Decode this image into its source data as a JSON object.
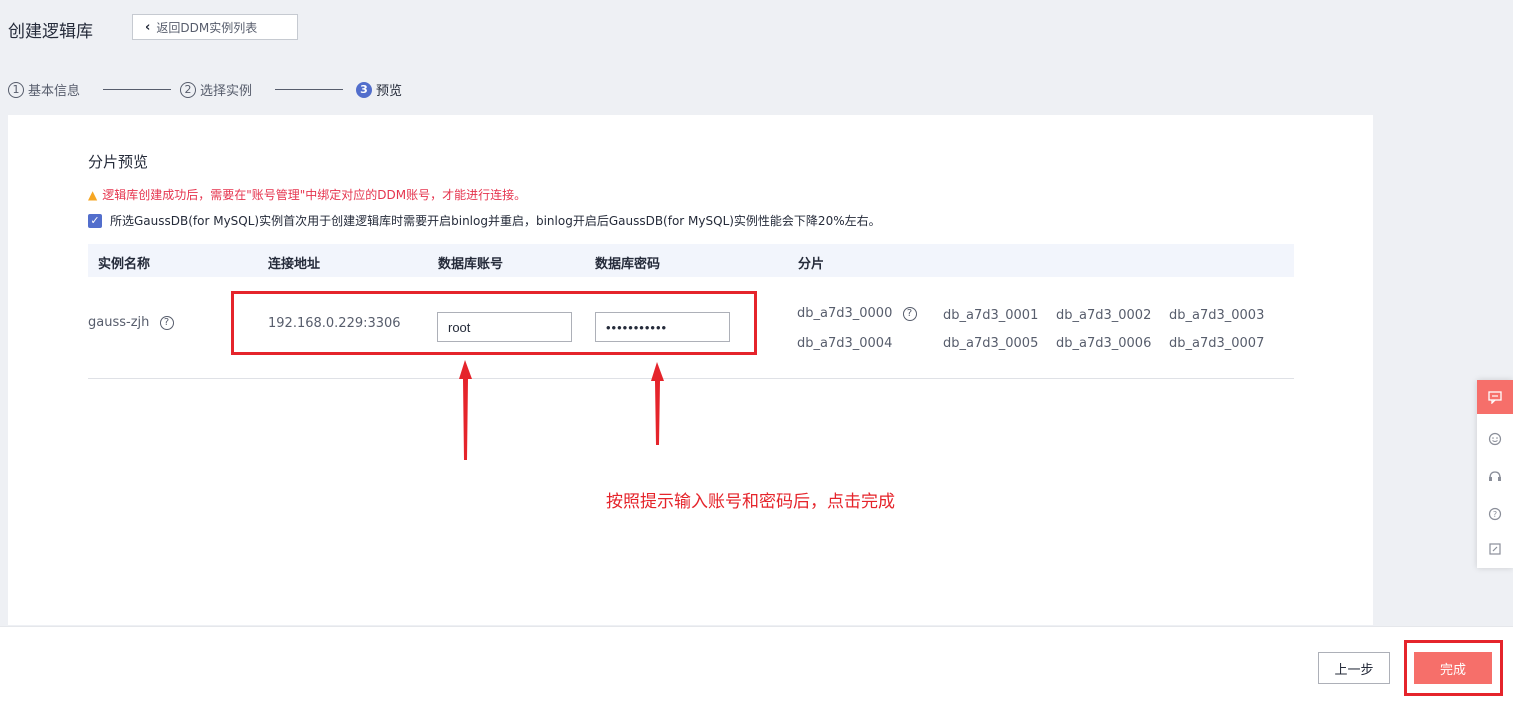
{
  "header": {
    "title": "创建逻辑库",
    "back_label": "返回DDM实例列表"
  },
  "steps": [
    {
      "num": "1",
      "label": "基本信息"
    },
    {
      "num": "2",
      "label": "选择实例"
    },
    {
      "num": "3",
      "label": "预览"
    }
  ],
  "section": {
    "title": "分片预览",
    "warning": "逻辑库创建成功后，需要在\"账号管理\"中绑定对应的DDM账号，才能进行连接。",
    "checkbox_text": "所选GaussDB(for MySQL)实例首次用于创建逻辑库时需要开启binlog并重启，binlog开启后GaussDB(for MySQL)实例性能会下降20%左右。",
    "checkbox_checked": true
  },
  "table": {
    "headers": [
      "实例名称",
      "连接地址",
      "数据库账号",
      "数据库密码",
      "分片"
    ],
    "row": {
      "instance_name": "gauss-zjh",
      "address": "192.168.0.229:3306",
      "account": "root",
      "password": "•••••••••••",
      "shards": [
        "db_a7d3_0000",
        "db_a7d3_0001",
        "db_a7d3_0002",
        "db_a7d3_0003",
        "db_a7d3_0004",
        "db_a7d3_0005",
        "db_a7d3_0006",
        "db_a7d3_0007"
      ]
    }
  },
  "annotation": {
    "text": "按照提示输入账号和密码后，点击完成",
    "color": "#e5242b"
  },
  "footer": {
    "prev_label": "上一步",
    "finish_label": "完成"
  },
  "colors": {
    "accent": "#526ecc",
    "finish": "#f66f6a",
    "warning_text": "#e5344e"
  },
  "float_toolbar": [
    "feedback-icon",
    "smile-icon",
    "headset-icon",
    "help-icon",
    "edit-icon"
  ]
}
